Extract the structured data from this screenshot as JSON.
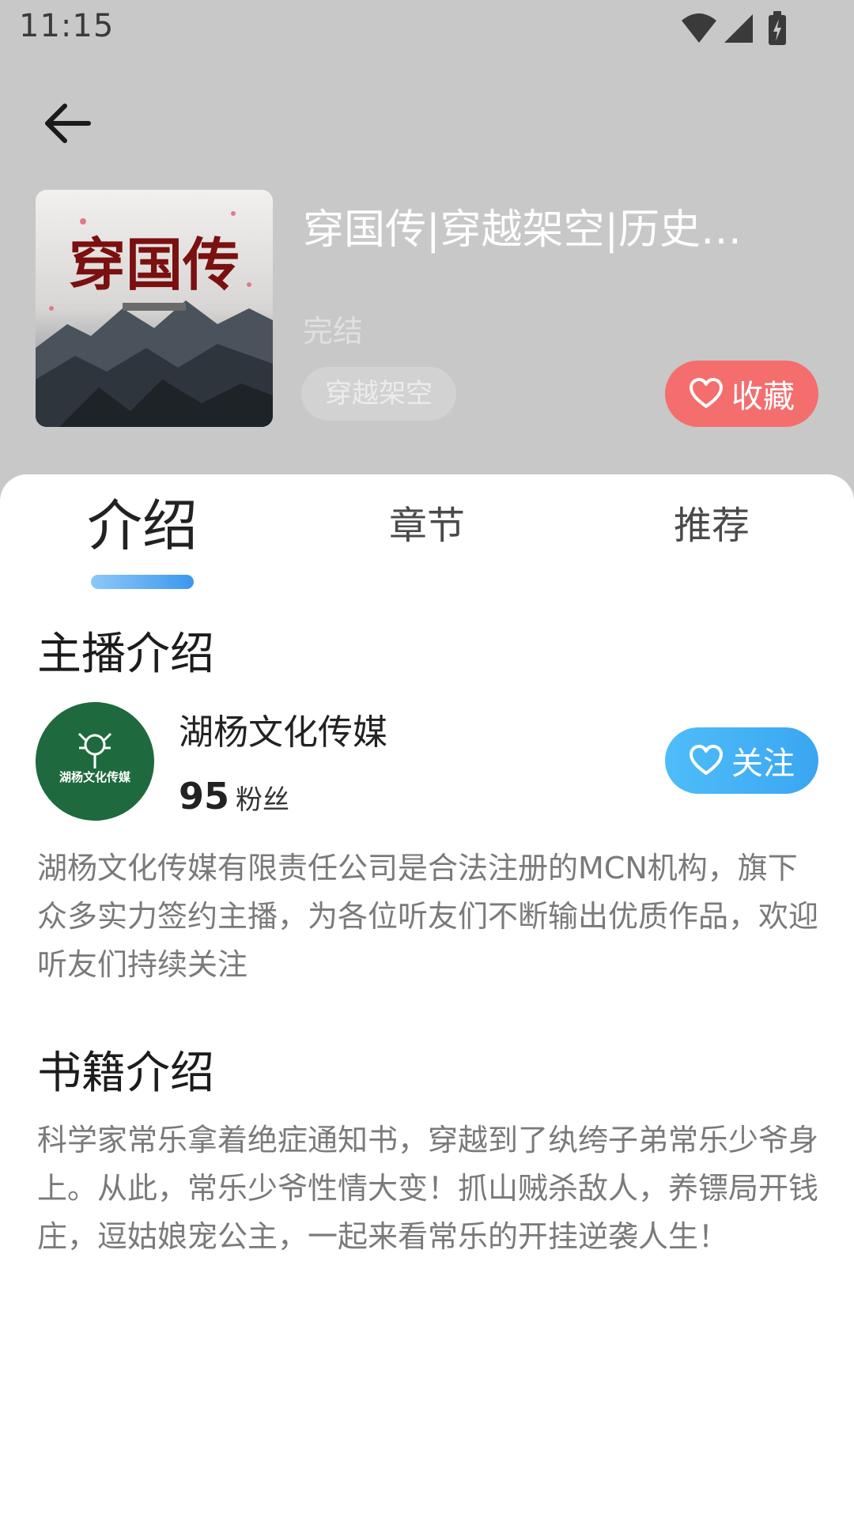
{
  "status_bar": {
    "time": "11:15"
  },
  "book": {
    "title": "穿国传|穿越架空|历史…",
    "status": "完结",
    "genre_tag": "穿越架空",
    "collect_label": "收藏",
    "cover_text": "穿国传"
  },
  "tabs": [
    {
      "label": "介绍",
      "active": true
    },
    {
      "label": "章节",
      "active": false
    },
    {
      "label": "推荐",
      "active": false
    }
  ],
  "host_section": {
    "title": "主播介绍",
    "name": "湖杨文化传媒",
    "fans_count": "95",
    "fans_label": "粉丝",
    "follow_label": "关注",
    "avatar_text": "湖杨文化传媒",
    "description": "湖杨文化传媒有限责任公司是合法注册的MCN机构，旗下众多实力签约主播，为各位听友们不断输出优质作品，欢迎听友们持续关注"
  },
  "book_section": {
    "title": "书籍介绍",
    "description": "科学家常乐拿着绝症通知书，穿越到了纨绔子弟常乐少爷身上。从此，常乐少爷性情大变！抓山贼杀敌人，养镖局开钱庄，逗姑娘宠公主，一起来看常乐的开挂逆袭人生！"
  },
  "colors": {
    "header_bg": "#c8c8c8",
    "collect_button": "#f46e6e",
    "follow_button": "#3aa6f2",
    "tab_indicator": "#3b98ee"
  }
}
